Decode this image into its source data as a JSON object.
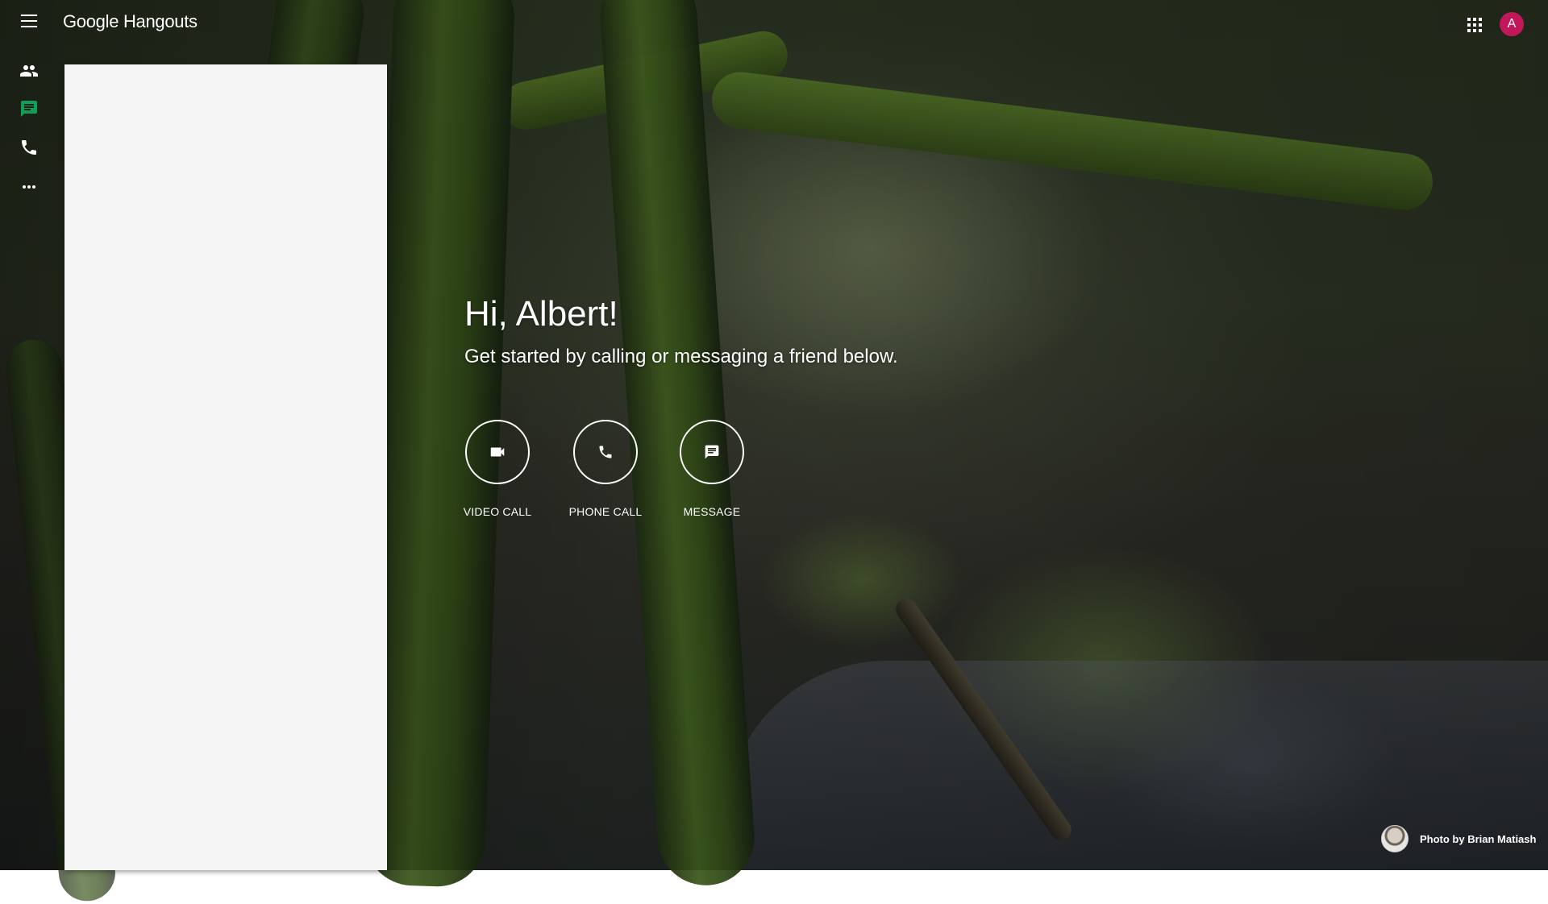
{
  "app": {
    "logo_google": "Google",
    "logo_product": "Hangouts",
    "avatar_letter": "A",
    "avatar_color": "#c2185b",
    "accent_color": "#0f9d58"
  },
  "nav": {
    "items": [
      {
        "icon": "people-icon",
        "label": "Contacts"
      },
      {
        "icon": "chat-icon",
        "label": "Conversations",
        "active": true
      },
      {
        "icon": "phone-icon",
        "label": "Phone calls"
      },
      {
        "icon": "more-icon",
        "label": "More"
      }
    ]
  },
  "greeting": {
    "title": "Hi, Albert!",
    "subtitle": "Get started by calling or messaging a friend below."
  },
  "actions": [
    {
      "icon": "videocam-icon",
      "label": "VIDEO CALL"
    },
    {
      "icon": "phone-icon",
      "label": "PHONE CALL"
    },
    {
      "icon": "message-icon",
      "label": "MESSAGE"
    }
  ],
  "credit": {
    "text": "Photo by Brian Matiash"
  }
}
